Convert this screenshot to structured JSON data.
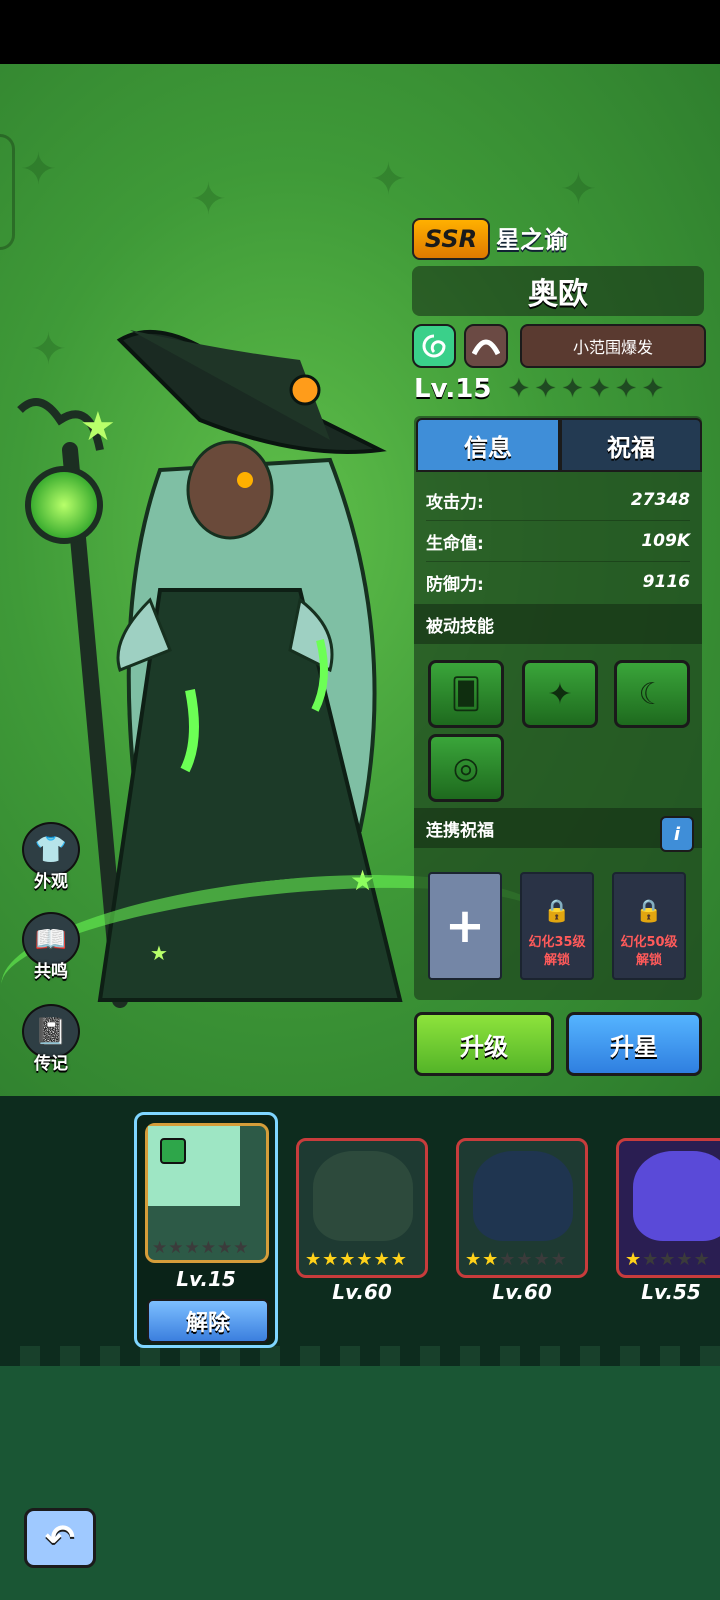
{
  "hero": {
    "rarity": "SSR",
    "title": "星之谕",
    "name": "奥欧",
    "skill_tag": "小范围爆发",
    "level": "Lv.15",
    "stars_total": 6,
    "stars_filled": 0
  },
  "tabs": [
    {
      "label": "信息",
      "active": true
    },
    {
      "label": "祝福",
      "active": false
    }
  ],
  "stats": [
    {
      "label": "攻击力:",
      "value": "27348"
    },
    {
      "label": "生命值:",
      "value": "109K"
    },
    {
      "label": "防御力:",
      "value": "9116"
    }
  ],
  "sections": {
    "passive": "被动技能",
    "link": "连携祝福"
  },
  "passive_skills": [
    {
      "icon": "cards-icon"
    },
    {
      "icon": "stars-icon"
    },
    {
      "icon": "moon-icon"
    },
    {
      "icon": "target-icon"
    }
  ],
  "link_slots": {
    "add": "+",
    "locked": [
      {
        "line1": "幻化35级",
        "line2": "解锁"
      },
      {
        "line1": "幻化50级",
        "line2": "解锁"
      }
    ]
  },
  "buttons": {
    "upgrade": "升级",
    "star_up": "升星",
    "remove": "解除"
  },
  "side_menu": [
    {
      "label": "外观",
      "icon": "shirt-icon"
    },
    {
      "label": "共鸣",
      "icon": "book-icon"
    },
    {
      "label": "传记",
      "icon": "journal-icon"
    }
  ],
  "pets": [
    {
      "level": "Lv.15",
      "stars": 0,
      "selected": true
    },
    {
      "level": "Lv.60",
      "stars": 6,
      "selected": false
    },
    {
      "level": "Lv.60",
      "stars": 2,
      "selected": false
    },
    {
      "level": "Lv.55",
      "stars": 1,
      "selected": false
    }
  ],
  "colors": {
    "accent_blue": "#3f8ed8",
    "upgrade_green": "#6fd232",
    "rarity_orange": "#ffa000",
    "lock_red": "#ff5a5a"
  }
}
